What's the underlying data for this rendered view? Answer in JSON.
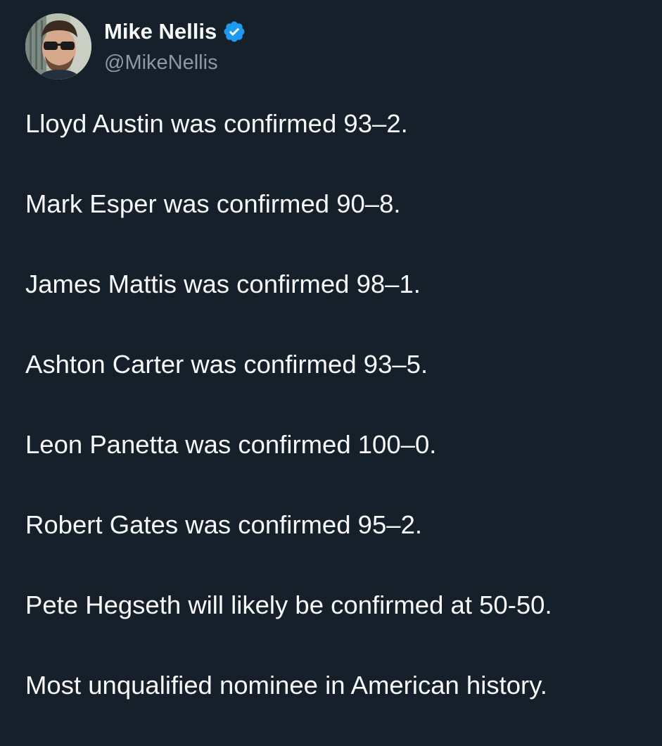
{
  "tweet": {
    "display_name": "Mike Nellis",
    "handle": "@MikeNellis",
    "verified_icon": "verified-badge-icon",
    "lines": [
      "Lloyd Austin was confirmed 93–2.",
      "Mark Esper was confirmed 90–8.",
      "James Mattis was confirmed 98–1.",
      "Ashton Carter was confirmed 93–5.",
      "Leon Panetta was confirmed 100–0.",
      "Robert Gates was confirmed 95–2.",
      "Pete Hegseth will likely be confirmed at 50-50.",
      "Most unqualified nominee in American history."
    ]
  },
  "colors": {
    "background": "#15202b",
    "text": "#f7f9f9",
    "secondary_text": "#8b98a5",
    "verified_blue": "#1d9bf0"
  }
}
